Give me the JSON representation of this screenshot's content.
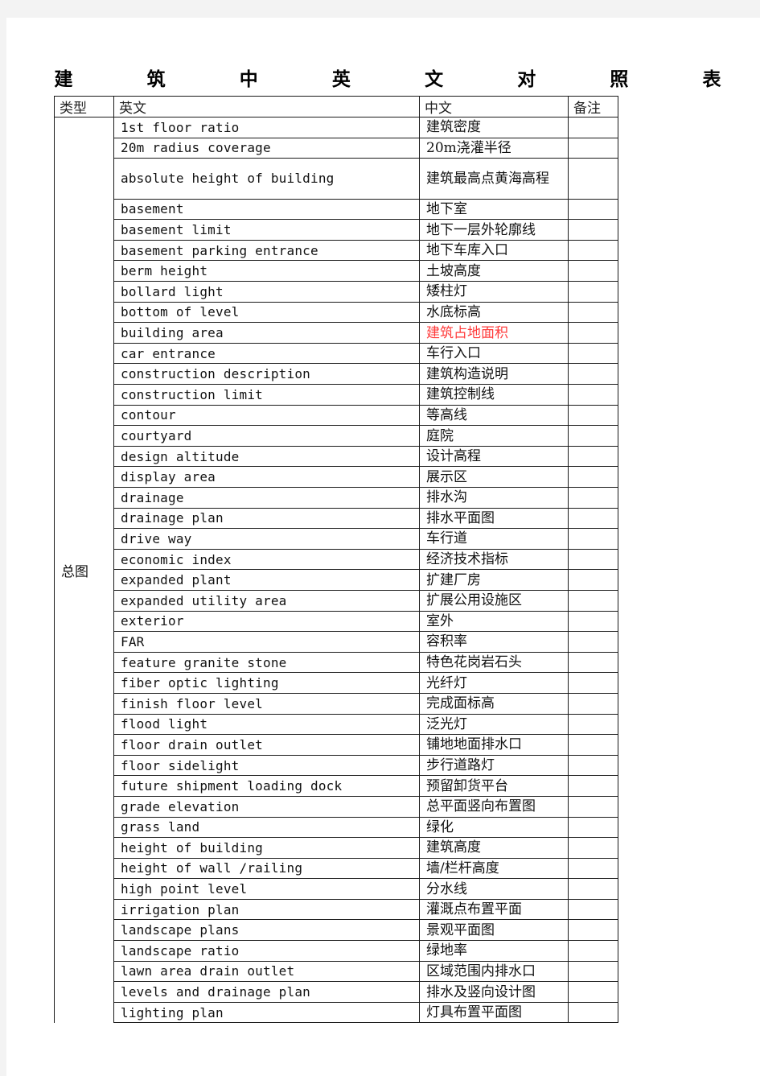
{
  "title_chars": [
    "建",
    "筑",
    "中",
    "英",
    "文",
    "对",
    "照",
    "表"
  ],
  "table": {
    "headers": {
      "category": "类型",
      "english": "英文",
      "chinese": "中文",
      "notes": "备注"
    },
    "category": "总图",
    "highlight_color": "#ff3b3b",
    "rows": [
      {
        "en": "1st floor ratio",
        "zh": "建筑密度",
        "note": ""
      },
      {
        "en": "20m radius coverage",
        "zh": "20m浇灌半径",
        "note": ""
      },
      {
        "en": "absolute height of building",
        "zh": "建筑最高点黄海高程",
        "note": ""
      },
      {
        "en": "basement",
        "zh": "地下室",
        "note": ""
      },
      {
        "en": "basement limit",
        "zh": "地下一层外轮廓线",
        "note": ""
      },
      {
        "en": "basement parking entrance",
        "zh": "地下车库入口",
        "note": ""
      },
      {
        "en": "berm height",
        "zh": "土坡高度",
        "note": ""
      },
      {
        "en": "bollard light",
        "zh": "矮柱灯",
        "note": ""
      },
      {
        "en": "bottom of level",
        "zh": "水底标高",
        "note": ""
      },
      {
        "en": "building area",
        "zh": "建筑占地面积",
        "note": "",
        "highlight": true
      },
      {
        "en": "car entrance",
        "zh": "车行入口",
        "note": ""
      },
      {
        "en": "construction description",
        "zh": "建筑构造说明",
        "note": ""
      },
      {
        "en": "construction limit",
        "zh": "建筑控制线",
        "note": ""
      },
      {
        "en": "contour",
        "zh": "等高线",
        "note": ""
      },
      {
        "en": "courtyard",
        "zh": "庭院",
        "note": ""
      },
      {
        "en": "design altitude",
        "zh": "设计高程",
        "note": ""
      },
      {
        "en": "display area",
        "zh": "展示区",
        "note": ""
      },
      {
        "en": "drainage",
        "zh": "排水沟",
        "note": ""
      },
      {
        "en": "drainage plan",
        "zh": "排水平面图",
        "note": ""
      },
      {
        "en": "drive  way",
        "zh": "车行道",
        "note": ""
      },
      {
        "en": "economic index",
        "zh": "经济技术指标",
        "note": ""
      },
      {
        "en": "expanded plant",
        "zh": "扩建厂房",
        "note": ""
      },
      {
        "en": "expanded utility area",
        "zh": "扩展公用设施区",
        "note": ""
      },
      {
        "en": "exterior",
        "zh": "室外",
        "note": ""
      },
      {
        "en": "FAR",
        "zh": "容积率",
        "note": ""
      },
      {
        "en": "feature granite stone",
        "zh": "特色花岗岩石头",
        "note": ""
      },
      {
        "en": "fiber optic lighting",
        "zh": "光纤灯",
        "note": ""
      },
      {
        "en": "finish floor level",
        "zh": "完成面标高",
        "note": ""
      },
      {
        "en": "flood light",
        "zh": "泛光灯",
        "note": ""
      },
      {
        "en": "floor drain outlet",
        "zh": "铺地地面排水口",
        "note": ""
      },
      {
        "en": "floor sidelight",
        "zh": "步行道路灯",
        "note": ""
      },
      {
        "en": "future shipment loading dock",
        "zh": "预留卸货平台",
        "note": ""
      },
      {
        "en": "grade elevation",
        "zh": "总平面竖向布置图",
        "note": ""
      },
      {
        "en": "grass land",
        "zh": "绿化",
        "note": ""
      },
      {
        "en": "height of building",
        "zh": "建筑高度",
        "note": ""
      },
      {
        "en": "height of wall /railing",
        "zh": "墙/栏杆高度",
        "note": ""
      },
      {
        "en": "high point level",
        "zh": "分水线",
        "note": ""
      },
      {
        "en": "irrigation plan",
        "zh": "灌溉点布置平面",
        "note": ""
      },
      {
        "en": "landscape plans",
        "zh": "景观平面图",
        "note": ""
      },
      {
        "en": "landscape ratio",
        "zh": "绿地率",
        "note": ""
      },
      {
        "en": "lawn area drain outlet",
        "zh": "区域范围内排水口",
        "note": ""
      },
      {
        "en": "levels and drainage plan",
        "zh": "排水及竖向设计图",
        "note": ""
      },
      {
        "en": "lighting plan",
        "zh": "灯具布置平面图",
        "note": ""
      }
    ]
  }
}
